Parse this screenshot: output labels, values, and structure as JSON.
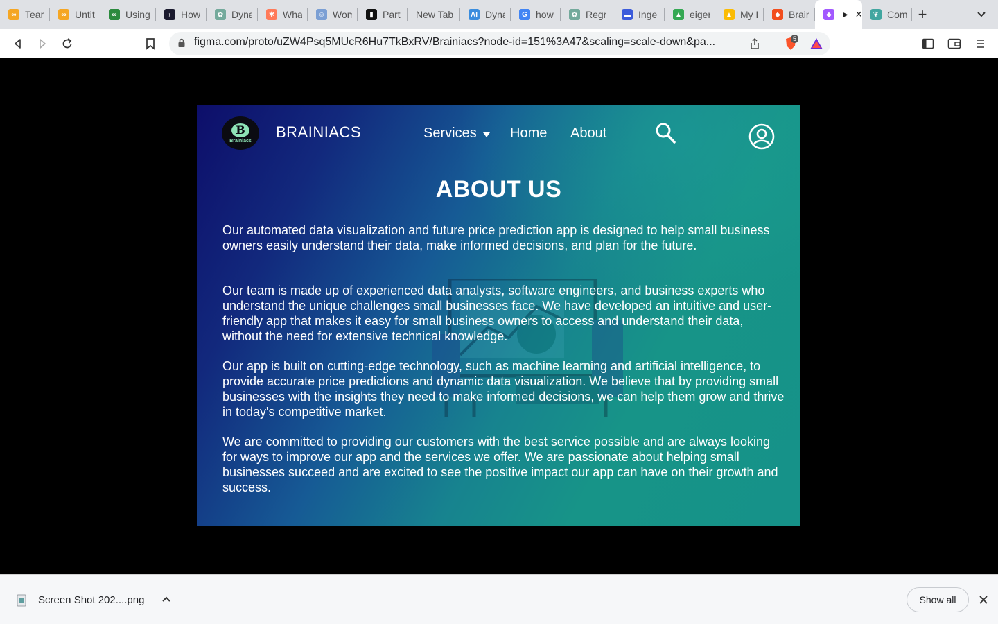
{
  "browser": {
    "tabs": [
      {
        "title": "Team",
        "favicon": "cocode-icon",
        "color": "#f5a623"
      },
      {
        "title": "Untit",
        "favicon": "cocode-icon",
        "color": "#f5a623"
      },
      {
        "title": "Using",
        "favicon": "oo-icon",
        "color": "#2b8a3e"
      },
      {
        "title": "How",
        "favicon": "chevron-circle-icon",
        "color": "#1a1a2e"
      },
      {
        "title": "Dyna",
        "favicon": "openai-icon",
        "color": "#74aa9c"
      },
      {
        "title": "What",
        "favicon": "hubspot-icon",
        "color": "#ff7a59"
      },
      {
        "title": "Wom",
        "favicon": "robot-icon",
        "color": "#7b9fd4"
      },
      {
        "title": "Part",
        "favicon": "chart-circle-icon",
        "color": "#111111"
      },
      {
        "title": "New Tab",
        "favicon": "",
        "color": ""
      },
      {
        "title": "Dyna",
        "favicon": "ai-icon",
        "color": "#3a8dde"
      },
      {
        "title": "how",
        "favicon": "google-icon",
        "color": "#4285f4"
      },
      {
        "title": "Regr",
        "favicon": "openai-icon",
        "color": "#74aa9c"
      },
      {
        "title": "Inge",
        "favicon": "doc-icon",
        "color": "#3b5bdb"
      },
      {
        "title": "eiger",
        "favicon": "drive-icon",
        "color": "#34a853"
      },
      {
        "title": "My D",
        "favicon": "drive-icon",
        "color": "#fbbc04"
      },
      {
        "title": "Brain",
        "favicon": "figma-icon",
        "color": "#f24e1e"
      },
      {
        "title": "",
        "favicon": "figma-icon",
        "color": "#a259ff",
        "active": true
      },
      {
        "title": "Com",
        "favicon": "leaf-icon",
        "color": "#41a6a0"
      }
    ],
    "url": "figma.com/proto/uZW4Psq5MUcR6Hu7TkBxRV/Brainiacs?node-id=151%3A47&scaling=scale-down&pa...",
    "brave_badge": "5"
  },
  "site": {
    "logo_letter": "B",
    "logo_small": "Brainiacs",
    "brand": "BRAINIACS",
    "nav": {
      "services": "Services",
      "home": "Home",
      "about": "About"
    },
    "title": "ABOUT US",
    "paragraphs": [
      "Our automated data visualization and future price prediction app is designed to help small business owners easily understand their data, make informed decisions, and plan for the future.",
      "Our team is made up of experienced data analysts, software engineers, and business experts who understand the unique challenges small businesses face. We have developed an intuitive and user-friendly app that makes it easy for small business owners to access and understand their data, without the need for extensive technical knowledge.",
      "Our app is built on cutting-edge technology, such as machine learning and artificial intelligence, to provide accurate price predictions and dynamic data visualization. We believe that by providing small businesses with the insights they need to make informed decisions, we can help them grow and thrive in today's competitive market.",
      "We are committed to providing our customers with the best service possible and are always looking for ways to improve our app and the services we offer. We are passionate about helping small businesses succeed and are excited to see the positive impact our app can have on their growth and success."
    ]
  },
  "downloads": {
    "file_name": "Screen Shot 202....png",
    "show_all": "Show all"
  },
  "colors": {
    "frame_start": "#0d0e6a",
    "frame_end": "#169289",
    "logo_accent": "#8ee3b6"
  }
}
